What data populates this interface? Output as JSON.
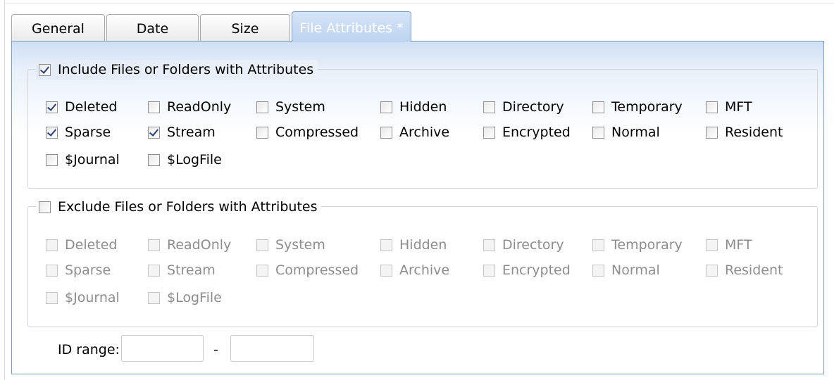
{
  "tabs": [
    {
      "label": "General",
      "active": false
    },
    {
      "label": "Date",
      "active": false
    },
    {
      "label": "Size",
      "active": false
    },
    {
      "label": "File Attributes *",
      "active": true
    }
  ],
  "include_group": {
    "title": "Include Files or Folders with Attributes",
    "enabled": true,
    "checked": true,
    "attributes": [
      {
        "label": "Deleted",
        "checked": true
      },
      {
        "label": "ReadOnly",
        "checked": false
      },
      {
        "label": "System",
        "checked": false
      },
      {
        "label": "Hidden",
        "checked": false
      },
      {
        "label": "Directory",
        "checked": false
      },
      {
        "label": "Temporary",
        "checked": false
      },
      {
        "label": "MFT",
        "checked": false
      },
      {
        "label": "Sparse",
        "checked": true
      },
      {
        "label": "Stream",
        "checked": true
      },
      {
        "label": "Compressed",
        "checked": false
      },
      {
        "label": "Archive",
        "checked": false
      },
      {
        "label": "Encrypted",
        "checked": false
      },
      {
        "label": "Normal",
        "checked": false
      },
      {
        "label": "Resident",
        "checked": false
      },
      {
        "label": "$Journal",
        "checked": false
      },
      {
        "label": "$LogFile",
        "checked": false
      }
    ]
  },
  "exclude_group": {
    "title": "Exclude Files or Folders with Attributes",
    "enabled": false,
    "checked": false,
    "attributes": [
      {
        "label": "Deleted",
        "checked": false
      },
      {
        "label": "ReadOnly",
        "checked": false
      },
      {
        "label": "System",
        "checked": false
      },
      {
        "label": "Hidden",
        "checked": false
      },
      {
        "label": "Directory",
        "checked": false
      },
      {
        "label": "Temporary",
        "checked": false
      },
      {
        "label": "MFT",
        "checked": false
      },
      {
        "label": "Sparse",
        "checked": false
      },
      {
        "label": "Stream",
        "checked": false
      },
      {
        "label": "Compressed",
        "checked": false
      },
      {
        "label": "Archive",
        "checked": false
      },
      {
        "label": "Encrypted",
        "checked": false
      },
      {
        "label": "Normal",
        "checked": false
      },
      {
        "label": "Resident",
        "checked": false
      },
      {
        "label": "$Journal",
        "checked": false
      },
      {
        "label": "$LogFile",
        "checked": false
      }
    ]
  },
  "id_range": {
    "label": "ID range:",
    "separator": "-",
    "from_value": "",
    "to_value": ""
  },
  "colors": {
    "active_tab": "#c4d8f2",
    "panel_border": "#7e9dc6",
    "check_mark": "#2a3f78",
    "disabled_text": "#8d8d8d"
  }
}
